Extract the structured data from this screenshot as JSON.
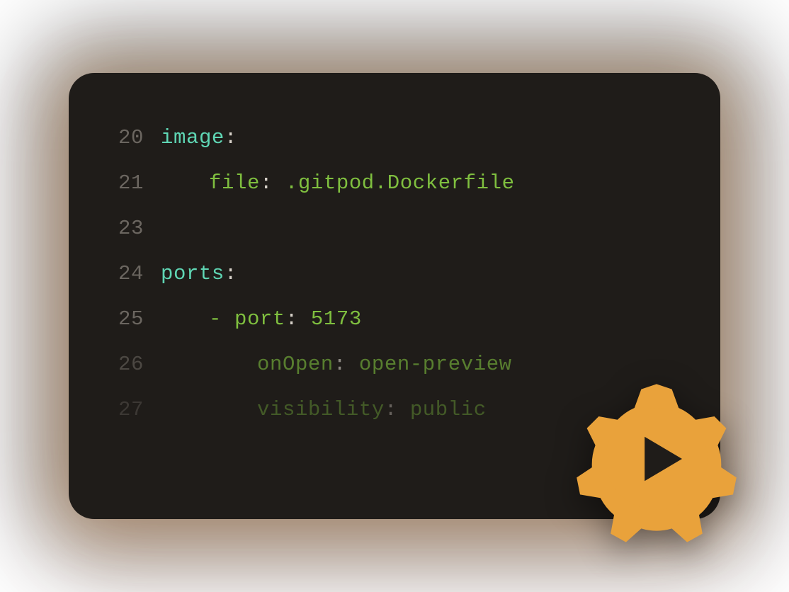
{
  "colors": {
    "editor_bg": "#1f1c19",
    "line_number": "#6b6660",
    "key": "#5fd6b4",
    "value": "#7fbf3f",
    "gear": "#e9a23b",
    "gear_inner": "#1f1c19"
  },
  "lines": [
    {
      "number": "20",
      "indent": 1,
      "tokens": [
        {
          "kind": "key",
          "text": "image"
        },
        {
          "kind": "colon",
          "text": ":"
        }
      ]
    },
    {
      "number": "21",
      "indent": 2,
      "tokens": [
        {
          "kind": "subkey",
          "text": "file"
        },
        {
          "kind": "colon",
          "text": ": "
        },
        {
          "kind": "value",
          "text": ".gitpod.Dockerfile"
        }
      ]
    },
    {
      "number": "23",
      "indent": 1,
      "tokens": []
    },
    {
      "number": "24",
      "indent": 1,
      "tokens": [
        {
          "kind": "key",
          "text": "ports"
        },
        {
          "kind": "colon",
          "text": ":"
        }
      ]
    },
    {
      "number": "25",
      "indent": 2,
      "tokens": [
        {
          "kind": "dash",
          "text": "- "
        },
        {
          "kind": "subkey",
          "text": "port"
        },
        {
          "kind": "colon",
          "text": ": "
        },
        {
          "kind": "value",
          "text": "5173"
        }
      ]
    },
    {
      "number": "26",
      "indent": 3,
      "fade": 1,
      "tokens": [
        {
          "kind": "subkey",
          "text": "onOpen"
        },
        {
          "kind": "colon",
          "text": ": "
        },
        {
          "kind": "value",
          "text": "open-preview"
        }
      ]
    },
    {
      "number": "27",
      "indent": 3,
      "fade": 2,
      "tokens": [
        {
          "kind": "subkey",
          "text": "visibility"
        },
        {
          "kind": "colon",
          "text": ": "
        },
        {
          "kind": "value",
          "text": "public"
        }
      ]
    }
  ]
}
